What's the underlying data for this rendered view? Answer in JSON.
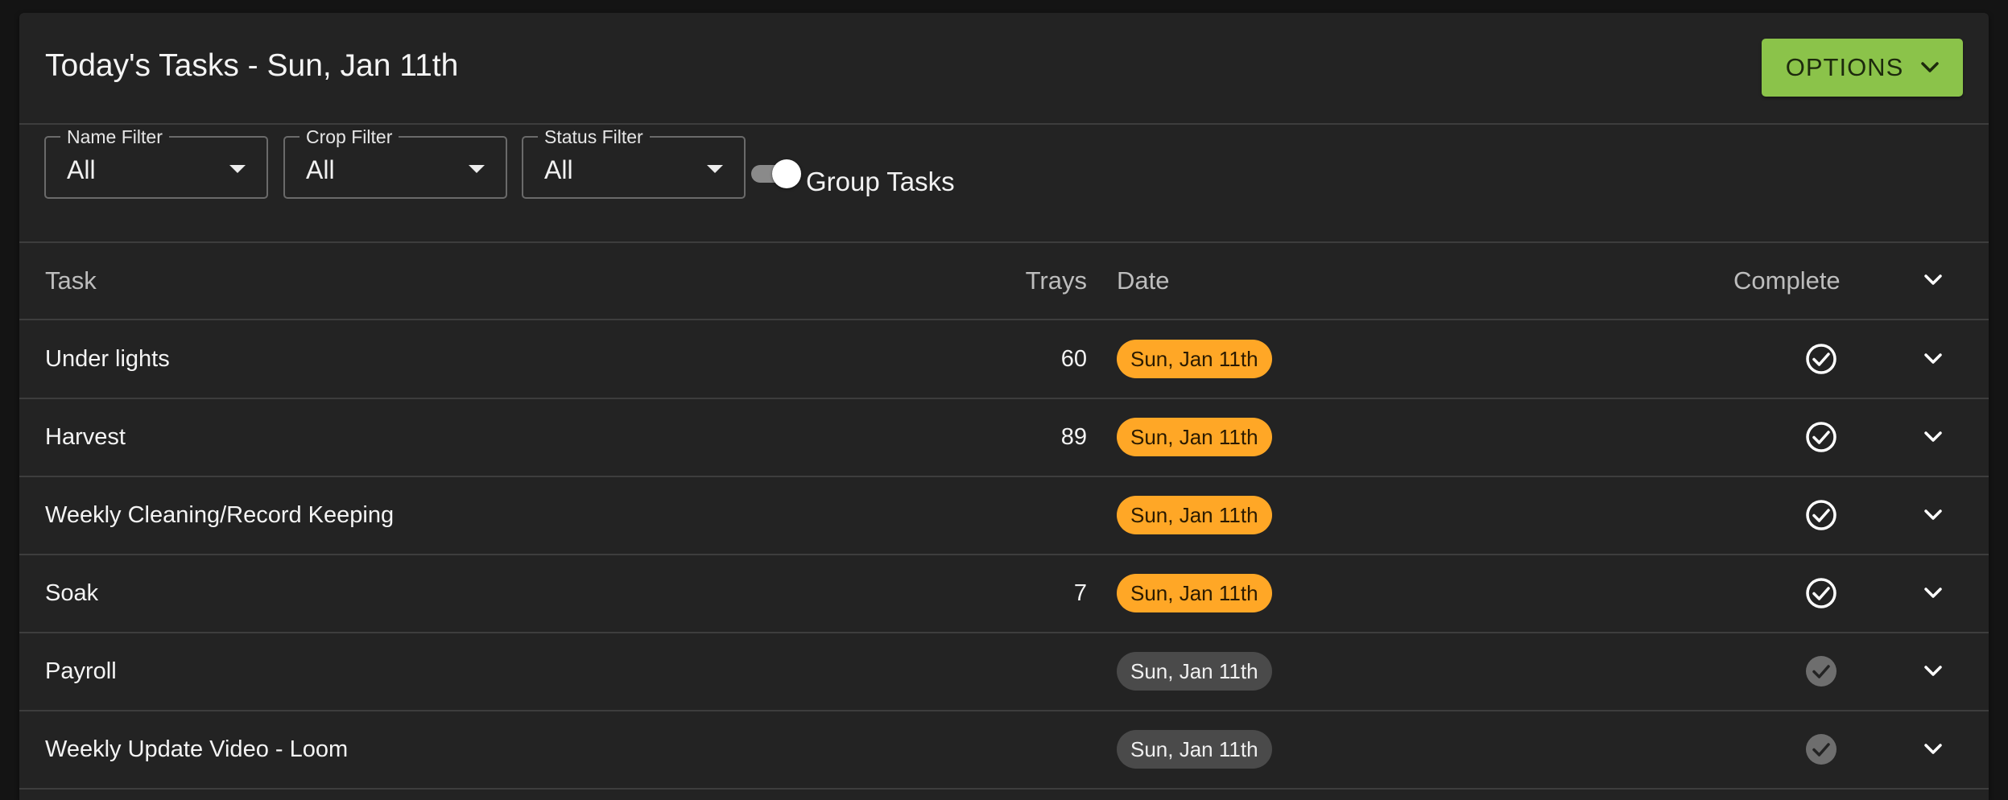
{
  "header": {
    "title": "Today's Tasks - Sun, Jan 11th",
    "options_label": "OPTIONS",
    "options_color": "#8bc34a"
  },
  "filters": {
    "name": {
      "label": "Name Filter",
      "value": "All"
    },
    "crop": {
      "label": "Crop Filter",
      "value": "All"
    },
    "status": {
      "label": "Status Filter",
      "value": "All"
    },
    "group_tasks": {
      "label": "Group Tasks",
      "enabled": true
    }
  },
  "table": {
    "columns": {
      "task": "Task",
      "trays": "Trays",
      "date": "Date",
      "complete": "Complete"
    },
    "rows": [
      {
        "task": "Under lights",
        "trays": "60",
        "date": "Sun, Jan 11th",
        "date_status": "due",
        "complete_icon": "check-circle-outline-icon"
      },
      {
        "task": "Harvest",
        "trays": "89",
        "date": "Sun, Jan 11th",
        "date_status": "due",
        "complete_icon": "check-circle-outline-icon"
      },
      {
        "task": "Weekly Cleaning/Record Keeping",
        "trays": "",
        "date": "Sun, Jan 11th",
        "date_status": "due",
        "complete_icon": "check-circle-outline-icon"
      },
      {
        "task": "Soak",
        "trays": "7",
        "date": "Sun, Jan 11th",
        "date_status": "due",
        "complete_icon": "check-circle-outline-icon"
      },
      {
        "task": "Payroll",
        "trays": "",
        "date": "Sun, Jan 11th",
        "date_status": "pending",
        "complete_icon": "check-circle-filled-icon"
      },
      {
        "task": "Weekly Update Video - Loom",
        "trays": "",
        "date": "Sun, Jan 11th",
        "date_status": "pending",
        "complete_icon": "check-circle-filled-icon"
      }
    ]
  },
  "colors": {
    "due_chip": "#ffa726",
    "pending_chip": "#4a4a4a",
    "card_background": "#232323"
  }
}
